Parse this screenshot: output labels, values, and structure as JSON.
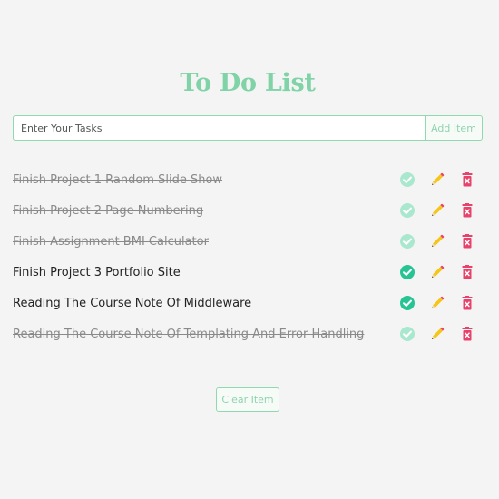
{
  "header": {
    "title": "To Do List"
  },
  "input": {
    "placeholder": "Enter Your Tasks",
    "value": ""
  },
  "buttons": {
    "add_label": "Add Item",
    "clear_label": "Clear Item"
  },
  "colors": {
    "accent": "#7fd3a6",
    "check_done": "#a9e8cf",
    "check_active": "#27c493",
    "pencil": "#f5c518",
    "trash": "#e8426a"
  },
  "tasks": [
    {
      "label": "Finish Project 1 Random Slide Show",
      "completed": true
    },
    {
      "label": "Finish Project 2 Page Numbering",
      "completed": true
    },
    {
      "label": "Finish Assignment BMI Calculator",
      "completed": true
    },
    {
      "label": "Finish Project 3 Portfolio Site",
      "completed": false
    },
    {
      "label": "Reading The Course Note Of Middleware",
      "completed": false
    },
    {
      "label": "Reading The Course Note Of Templating And Error Handling",
      "completed": true
    }
  ],
  "icons": {
    "complete": "check-circle-icon",
    "edit": "pencil-icon",
    "delete": "trash-icon"
  }
}
